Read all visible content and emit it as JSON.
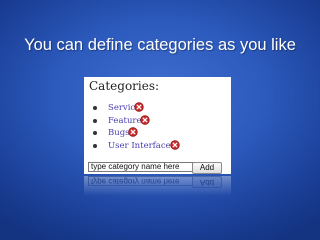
{
  "slide": {
    "title": "You can define categories as you like"
  },
  "widget": {
    "heading": "Categories:",
    "categories": [
      {
        "label": "Service",
        "delete_icon": "delete-x-icon"
      },
      {
        "label": "Features",
        "delete_icon": "delete-x-icon"
      },
      {
        "label": "Bugs",
        "delete_icon": "delete-x-icon"
      },
      {
        "label": "User Interface",
        "delete_icon": "delete-x-icon"
      }
    ],
    "input": {
      "value": "type category name here",
      "placeholder": "type category name here"
    },
    "add_label": "Add"
  },
  "colors": {
    "background": "#2c59bc",
    "title_text": "#ffffff",
    "category_link": "#4a3fae",
    "delete_icon": "#cf2a2a"
  }
}
